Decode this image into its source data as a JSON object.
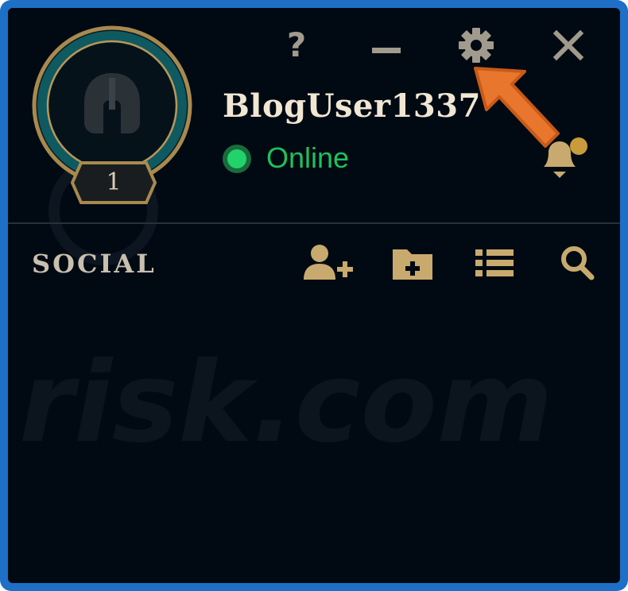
{
  "profile": {
    "username": "BlogUser1337",
    "level": "1",
    "status": "Online"
  },
  "window_controls": {
    "help_label": "?",
    "icons": [
      "help-icon",
      "minimize-icon",
      "gear-icon",
      "close-icon"
    ]
  },
  "social": {
    "title": "SOCIAL",
    "tools": [
      "add-friend-icon",
      "add-folder-icon",
      "list-icon",
      "search-icon"
    ]
  },
  "watermark": "risk.com",
  "colors": {
    "background": "#010a13",
    "frame": "#1e6fc6",
    "gold": "#c8aa6e",
    "icon_gray": "#a09b8c",
    "online_green": "#1ec15c",
    "annotation_arrow": "#e8762c"
  }
}
